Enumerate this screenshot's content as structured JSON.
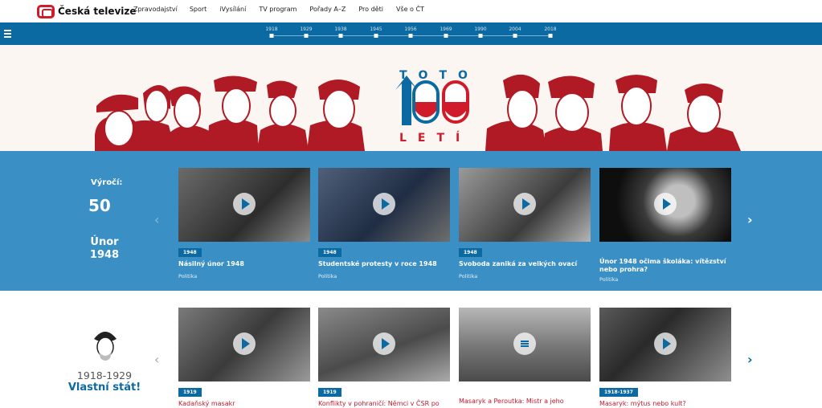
{
  "header": {
    "logo_text": "Česká televize",
    "nav": [
      "Zpravodajství",
      "Sport",
      "iVysílání",
      "TV program",
      "Pořady A–Z",
      "Pro děti",
      "Vše o ČT"
    ]
  },
  "timeline": {
    "years": [
      "1918",
      "1929",
      "1938",
      "1945",
      "1956",
      "1969",
      "1990",
      "2004",
      "2018"
    ]
  },
  "hero": {
    "toto": "TOTO",
    "leti": "LETÍ"
  },
  "section1": {
    "label": "Výročí:",
    "badge_number": "50",
    "title_line1": "Únor",
    "title_line2": "1948",
    "cards": [
      {
        "badge": "1948",
        "title": "Násilný únor 1948",
        "category": "Politika"
      },
      {
        "badge": "1948",
        "title": "Studentské protesty v roce 1948",
        "category": "Politika"
      },
      {
        "badge": "1948",
        "title": "Svoboda zaniká za velkých ovací",
        "category": "Politika"
      },
      {
        "badge": "",
        "title": "Únor 1948 očima školáka: vítězství nebo prohra?",
        "category": "Politika"
      }
    ]
  },
  "section2": {
    "years": "1918-1929",
    "title": "Vlastní stát!",
    "cards": [
      {
        "badge": "1919",
        "title": "Kadaňský masakr"
      },
      {
        "badge": "1919",
        "title": "Konflikty v pohraničí: Němci v ČSR po"
      },
      {
        "badge": "",
        "title": "Masaryk a Peroutka: Mistr a jeho"
      },
      {
        "badge": "1918-1937",
        "title": "Masaryk: mýtus nebo kult?"
      }
    ]
  },
  "colors": {
    "brand_blue": "#0b6aa2",
    "band_blue": "#3a8fc4",
    "red": "#c4172c"
  }
}
